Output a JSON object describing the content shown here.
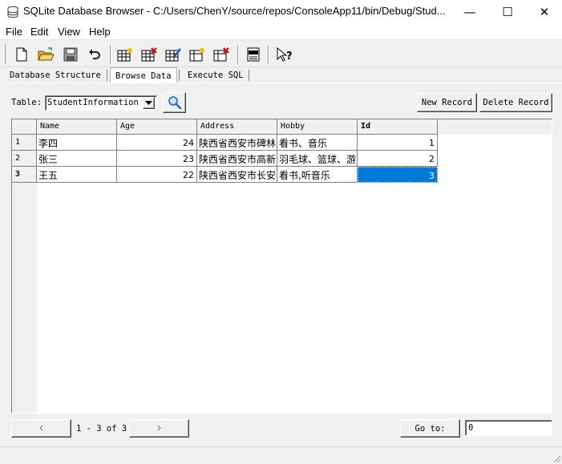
{
  "window": {
    "title": "SQLite Database Browser - C:/Users/ChenY/source/repos/ConsoleApp11/bin/Debug/Stud...",
    "minimize_glyph": "—",
    "maximize_glyph": "☐",
    "close_glyph": "✕"
  },
  "menu": [
    "File",
    "Edit",
    "View",
    "Help"
  ],
  "tabs": [
    {
      "label": "Database Structure",
      "active": false
    },
    {
      "label": "Browse Data",
      "active": true
    },
    {
      "label": "Execute SQL",
      "active": false
    }
  ],
  "browse": {
    "table_label": "Table:",
    "table_selected": "StudentInformation",
    "new_record": "New Record",
    "delete_record": "Delete Record"
  },
  "grid": {
    "columns": [
      "Name",
      "Age",
      "Address",
      "Hobby",
      "Id"
    ],
    "rows": [
      {
        "num": "1",
        "cells": [
          "李四",
          "24",
          "陕西省西安市碑林",
          "看书、音乐",
          "1"
        ]
      },
      {
        "num": "2",
        "cells": [
          "张三",
          "23",
          "陕西省西安市高新",
          "羽毛球、篮球、游",
          "2"
        ]
      },
      {
        "num": "3",
        "cells": [
          "王五",
          "22",
          "陕西省西安市长安",
          "看书,听音乐",
          "3"
        ]
      }
    ]
  },
  "nav": {
    "prev_glyph": "‹",
    "next_glyph": "›",
    "range_text": "1 - 3 of 3",
    "goto_label": "Go to:",
    "goto_value": "0"
  },
  "colors": {
    "selection": "#0078d7",
    "background": "#f0f0f0"
  }
}
